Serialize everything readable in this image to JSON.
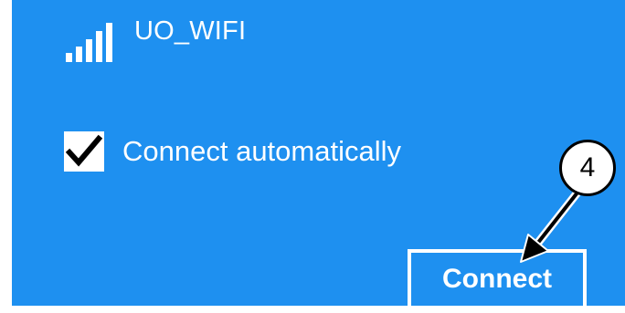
{
  "network": {
    "ssid": "UO_WIFI",
    "signal_icon": "wifi-signal-bars-icon"
  },
  "auto_connect": {
    "label": "Connect automatically",
    "checked": true
  },
  "connect_button": {
    "label": "Connect"
  },
  "annotation": {
    "step_number": "4"
  },
  "colors": {
    "panel_background": "#1e90f0",
    "text": "#ffffff",
    "annotation_stroke": "#000000"
  }
}
